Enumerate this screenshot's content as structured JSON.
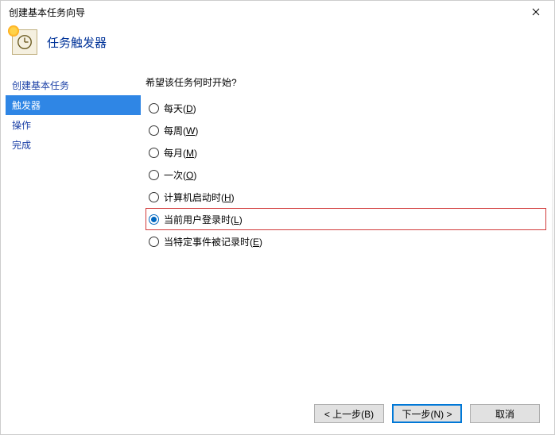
{
  "window": {
    "title": "创建基本任务向导"
  },
  "header": {
    "title": "任务触发器"
  },
  "sidebar": {
    "items": [
      {
        "label": "创建基本任务",
        "selected": false
      },
      {
        "label": "触发器",
        "selected": true
      },
      {
        "label": "操作",
        "selected": false
      },
      {
        "label": "完成",
        "selected": false
      }
    ]
  },
  "content": {
    "prompt": "希望该任务何时开始?",
    "options": [
      {
        "label": "每天(",
        "accel": "D",
        "suffix": ")",
        "checked": false,
        "highlight": false
      },
      {
        "label": "每周(",
        "accel": "W",
        "suffix": ")",
        "checked": false,
        "highlight": false
      },
      {
        "label": "每月(",
        "accel": "M",
        "suffix": ")",
        "checked": false,
        "highlight": false
      },
      {
        "label": "一次(",
        "accel": "O",
        "suffix": ")",
        "checked": false,
        "highlight": false
      },
      {
        "label": "计算机启动时(",
        "accel": "H",
        "suffix": ")",
        "checked": false,
        "highlight": false
      },
      {
        "label": "当前用户登录时(",
        "accel": "L",
        "suffix": ")",
        "checked": true,
        "highlight": true
      },
      {
        "label": "当特定事件被记录时(",
        "accel": "E",
        "suffix": ")",
        "checked": false,
        "highlight": false
      }
    ]
  },
  "footer": {
    "back": "< 上一步(B)",
    "next": "下一步(N) >",
    "cancel": "取消"
  }
}
